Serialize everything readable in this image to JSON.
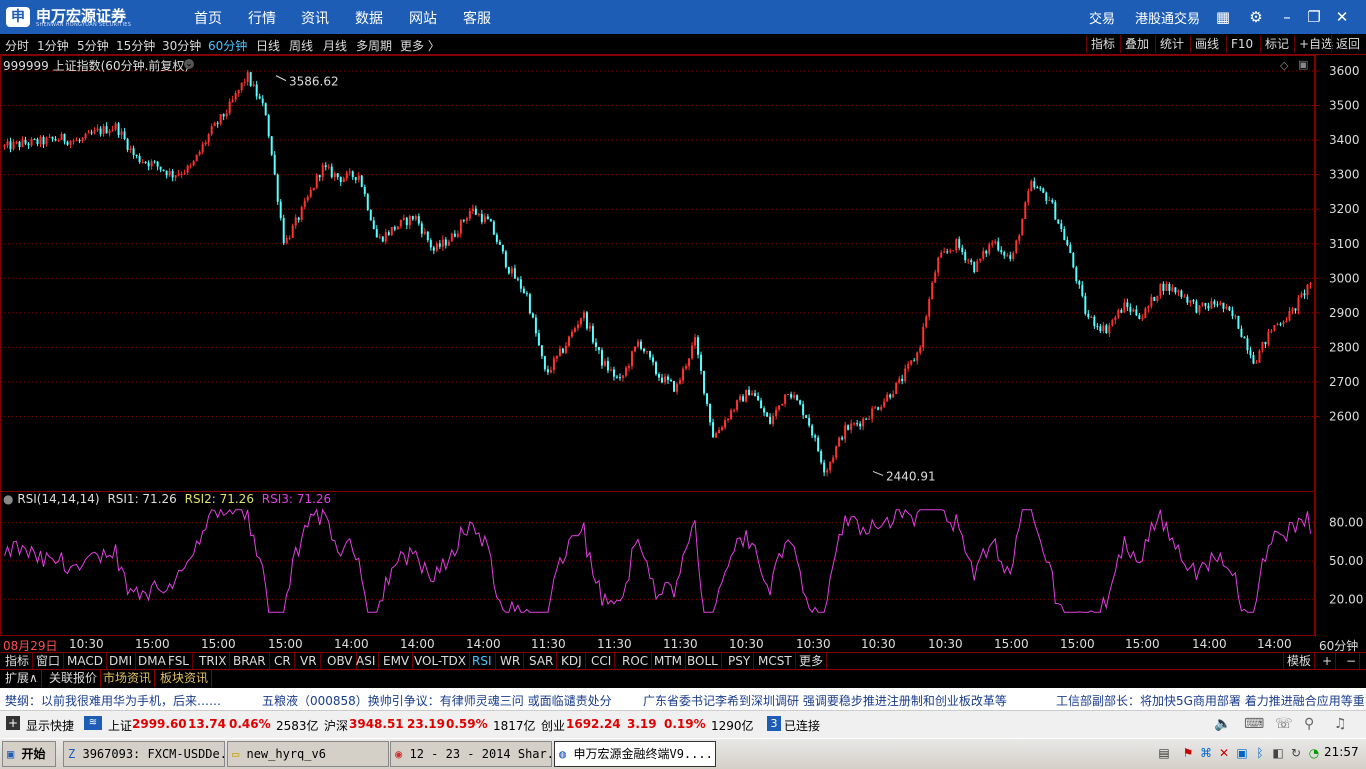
{
  "app": {
    "logo_mark": "申",
    "logo_text": "申万宏源证券",
    "logo_sub": "SHENWAN HONGYUAN SECURITIES",
    "menu": [
      "首页",
      "行情",
      "资讯",
      "数据",
      "网站",
      "客服"
    ],
    "right_links": [
      "交易",
      "港股通交易"
    ]
  },
  "periods": [
    "分时",
    "1分钟",
    "5分钟",
    "15分钟",
    "30分钟",
    "60分钟",
    "日线",
    "周线",
    "月线",
    "多周期",
    "更多 〉"
  ],
  "active_period": "60分钟",
  "tools": [
    "指标",
    "叠加",
    "统计",
    "画线",
    "F10",
    "标记",
    "+自选",
    "返回"
  ],
  "chart": {
    "symbol_label": "999999 上证指数(60分钟.前复权)",
    "high_label": "3586.62",
    "low_label": "2440.91",
    "y_ticks": [
      "3600",
      "3500",
      "3400",
      "3300",
      "3200",
      "3100",
      "3000",
      "2900",
      "2800",
      "2700",
      "2600"
    ],
    "rsi_ticks": [
      "80.00",
      "50.00",
      "20.00"
    ],
    "rsi_legend": {
      "name": "RSI(14,14,14)",
      "rsi1": "RSI1: 71.26",
      "rsi2": "RSI2: 71.26",
      "rsi3": "RSI3: 71.26"
    },
    "time_labels": [
      "08月29日",
      "10:30",
      "15:00",
      "15:00",
      "15:00",
      "14:00",
      "14:00",
      "14:00",
      "11:30",
      "11:30",
      "11:30",
      "10:30",
      "10:30",
      "10:30",
      "10:30",
      "15:00",
      "15:00",
      "15:00",
      "14:00",
      "14:00"
    ],
    "period_label": "60分钟",
    "colors": {
      "up": "#ff3232",
      "down": "#54ffff",
      "rsi": "#e040e0",
      "grid": "#800000"
    }
  },
  "chart_data": {
    "type": "candlestick",
    "title": "999999 上证指数(60分钟.前复权)",
    "price_axis": [
      2440.91,
      3586.62
    ],
    "anchor_prices": [
      3380,
      3390,
      3395,
      3405,
      3395,
      3425,
      3440,
      3350,
      3330,
      3300,
      3320,
      3420,
      3490,
      3586.62,
      3480,
      3100,
      3200,
      3320,
      3290,
      3300,
      3110,
      3150,
      3180,
      3080,
      3120,
      3200,
      3160,
      3030,
      2950,
      2720,
      2800,
      2900,
      2760,
      2700,
      2820,
      2720,
      2680,
      2820,
      2540,
      2620,
      2680,
      2580,
      2680,
      2600,
      2440.91,
      2560,
      2590,
      2640,
      2700,
      2790,
      3050,
      3100,
      3030,
      3110,
      3050,
      3270,
      3230,
      3090,
      2890,
      2850,
      2920,
      2890,
      2980,
      2960,
      2910,
      2930,
      2880,
      2760,
      2860,
      2900,
      2990
    ],
    "rsi_axis": [
      0,
      100
    ],
    "rsi_last": 71.26,
    "rsi_ticks": [
      80,
      50,
      20
    ]
  },
  "ind_tabs": [
    "指标",
    "窗口",
    "MACD",
    "DMI",
    "DMA",
    "FSL",
    "TRIX",
    "BRAR",
    "CR",
    "VR",
    "OBV",
    "ASI",
    "EMV",
    "VOL-TDX",
    "RSI",
    "WR",
    "SAR",
    "KDJ",
    "CCI",
    "ROC",
    "MTM",
    "BOLL",
    "PSY",
    "MCST",
    "更多"
  ],
  "active_ind": "RSI",
  "ind_right": [
    "模板",
    "+",
    "−"
  ],
  "ext_tabs": [
    "扩展∧",
    "关联报价",
    "市场资讯",
    "板块资讯"
  ],
  "news": [
    "樊纲：以前我很难用华为手机，后来……",
    "五粮液（000858）换帅引争议：有律师灵魂三问  或面临谴责处分",
    "广东省委书记李希到深圳调研  强调要稳步推进注册制和创业板改革等",
    "工信部副部长：将加快5G商用部署  着力推进融合应用等重"
  ],
  "status": {
    "toggle": "显示快捷",
    "sh_name": "上证",
    "sh_val": "2999.60",
    "sh_chg": "13.74",
    "sh_pct": "0.46%",
    "sh_amt": "2583亿",
    "sz_name": "沪深",
    "sz_val": "3948.51",
    "sz_chg": "23.19",
    "sz_pct": "0.59%",
    "sz_amt": "1817亿",
    "cy_name": "创业",
    "cy_val": "1692.24",
    "cy_chg": "3.19",
    "cy_pct": "0.19%",
    "cy_amt": "1290亿",
    "conn_num": "3",
    "conn": "已连接"
  },
  "taskbar": {
    "start": "开始",
    "buttons": [
      "3967093: FXCM-USDDe...",
      "new_hyrq_v6",
      "12 - 23 - 2014 Shar...",
      "申万宏源金融终端V9...."
    ],
    "clock": "21:57"
  }
}
